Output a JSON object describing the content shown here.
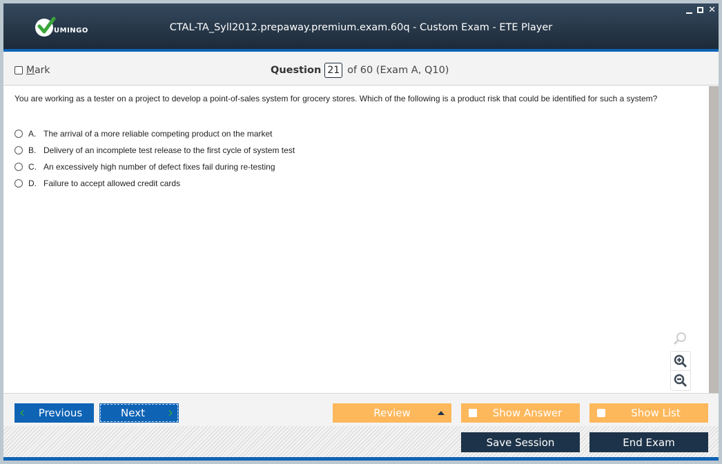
{
  "window": {
    "title": "CTAL-TA_Syll2012.prepaway.premium.exam.60q - Custom Exam - ETE Player",
    "logo_text": "UMINGO",
    "controls": [
      "minimize",
      "maximize",
      "close"
    ]
  },
  "question_bar": {
    "mark_label_prefix": "M",
    "mark_label_rest": "ark",
    "mark_checked": false,
    "question_label": "Question",
    "question_number": "21",
    "question_of": "of 60 (Exam A, Q10)"
  },
  "question": {
    "text": "You are working as a tester on a project to develop a point-of-sales system for grocery stores. Which of the following is a product risk that could be identified for such a system?",
    "options": [
      {
        "letter": "A.",
        "text": "The arrival of a more reliable competing product on the market",
        "selected": false
      },
      {
        "letter": "B.",
        "text": "Delivery of an incomplete test release to the first cycle of system test",
        "selected": false
      },
      {
        "letter": "C.",
        "text": "An excessively high number of defect fixes fail during re-testing",
        "selected": false
      },
      {
        "letter": "D.",
        "text": "Failure to accept allowed credit cards",
        "selected": false
      }
    ]
  },
  "zoom_tools": [
    "zoom-reset",
    "zoom-in",
    "zoom-out"
  ],
  "nav": {
    "previous_label": "Previous",
    "next_label": "Next",
    "review_label": "Review",
    "show_answer_label": "Show Answer",
    "show_list_label": "Show List"
  },
  "footer": {
    "save_label": "Save Session",
    "end_label": "End Exam"
  },
  "colors": {
    "brand_blue": "#0e63b5",
    "accent_orange": "#fdb85c",
    "dark_navy": "#1d3349",
    "chevron_green": "#3aa53a"
  }
}
